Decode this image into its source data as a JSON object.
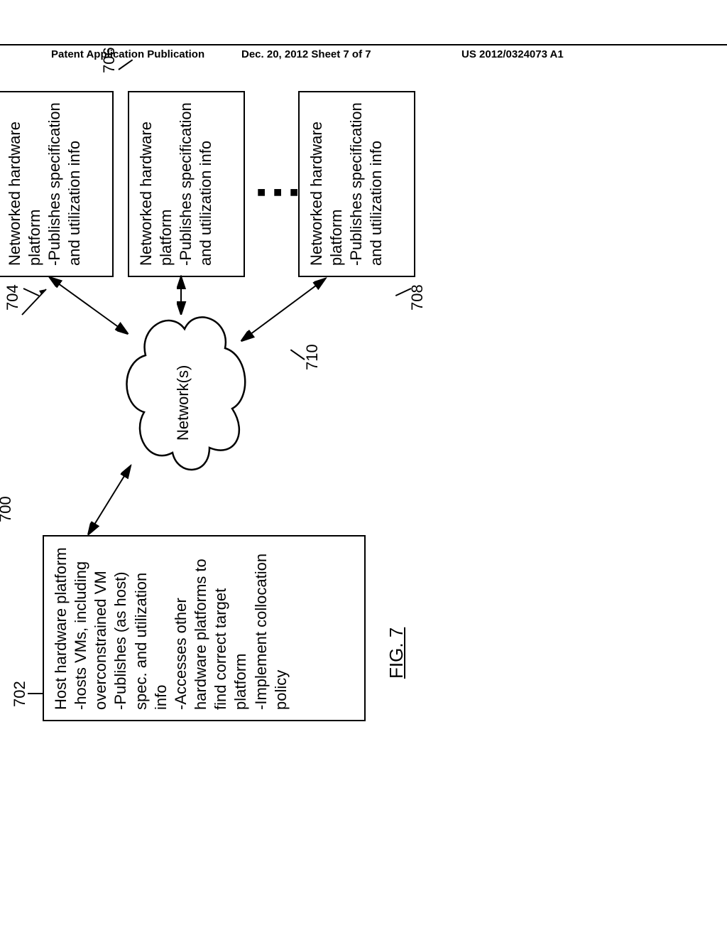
{
  "header": {
    "left": "Patent Application Publication",
    "mid": "Dec. 20, 2012  Sheet 7 of 7",
    "right": "US 2012/0324073 A1"
  },
  "refs": {
    "r700": "700",
    "r702": "702",
    "r704": "704",
    "r706": "706",
    "r708": "708",
    "r710": "710"
  },
  "host_box": {
    "title": "Host hardware platform",
    "l1": "-hosts VMs, including overconstrained VM",
    "l2": "-Publishes (as host) spec. and utilization info",
    "l3": "-Accesses other hardware platforms to find correct target platform",
    "l4": "-Implement collocation policy"
  },
  "net_box": {
    "title": "Networked hardware platform",
    "l1": "-Publishes specification and utilization info"
  },
  "cloud_label": "Network(s)",
  "dots": "■ ■ ■",
  "fig_caption": "FIG. 7"
}
